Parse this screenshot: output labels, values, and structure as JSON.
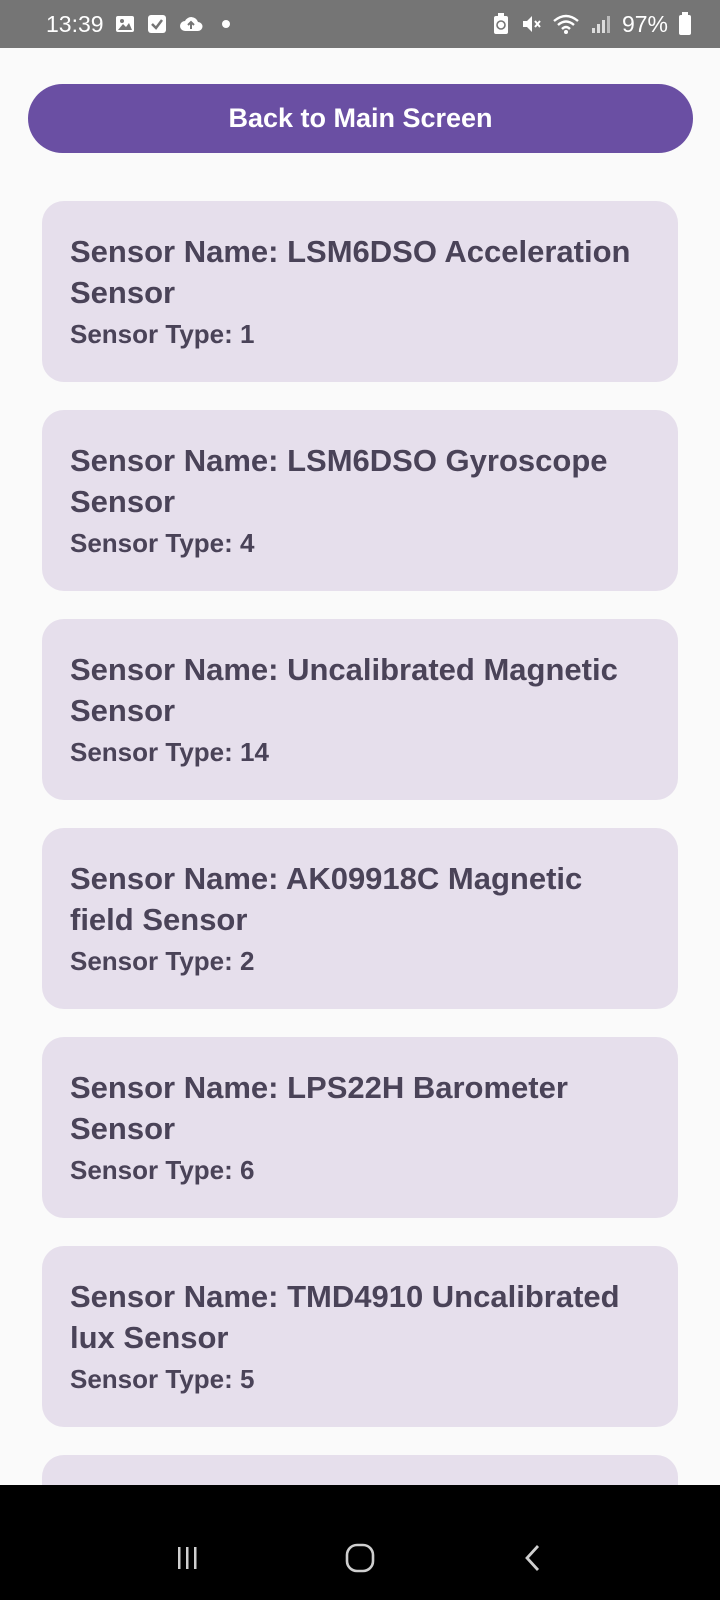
{
  "status_bar": {
    "time": "13:39",
    "battery": "97%",
    "left_icons": [
      "gallery-icon",
      "checkbox-icon",
      "cloud-upload-icon",
      "dot-icon"
    ],
    "right_icons": [
      "battery-saver-icon",
      "mute-icon",
      "wifi-icon",
      "signal-icon",
      "battery-icon"
    ]
  },
  "main": {
    "back_button_label": "Back to Main Screen",
    "sensors": [
      {
        "name": "Sensor Name: LSM6DSO Acceleration Sensor",
        "type": "Sensor Type: 1"
      },
      {
        "name": "Sensor Name: LSM6DSO Gyroscope Sensor",
        "type": "Sensor Type: 4"
      },
      {
        "name": "Sensor Name: Uncalibrated Magnetic Sensor",
        "type": "Sensor Type: 14"
      },
      {
        "name": "Sensor Name: AK09918C Magnetic field Sensor",
        "type": "Sensor Type: 2"
      },
      {
        "name": "Sensor Name: LPS22H Barometer Sensor",
        "type": "Sensor Type: 6"
      },
      {
        "name": "Sensor Name: TMD4910 Uncalibrated lux Sensor",
        "type": "Sensor Type: 5"
      }
    ]
  },
  "nav_bar": {
    "icons": [
      "recent-apps-icon",
      "home-icon",
      "back-icon"
    ]
  },
  "colors": {
    "status_bar": "#757575",
    "button": "#6a4fa3",
    "card": "#e6dfec",
    "card_text": "#4a4358",
    "background": "#fafafa"
  }
}
